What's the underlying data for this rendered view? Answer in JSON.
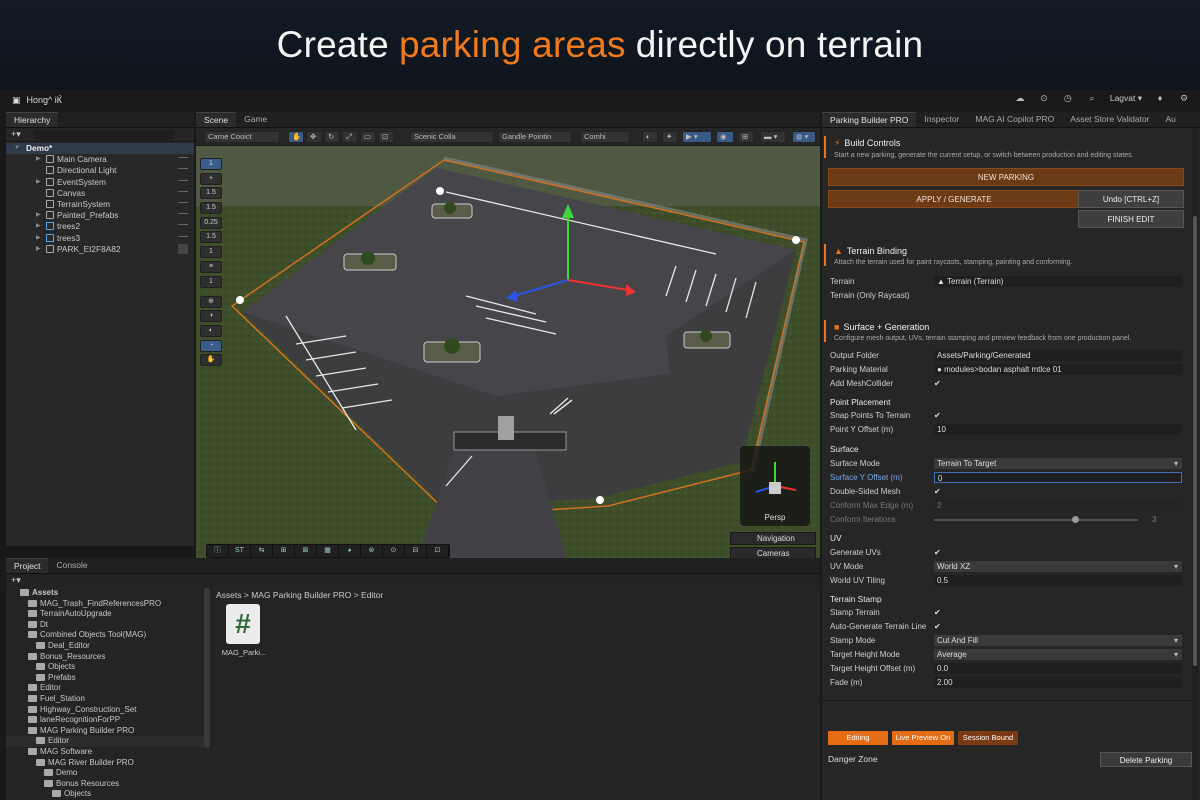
{
  "banner": {
    "prefix": "Create",
    "highlight": "parking areas",
    "suffix": "directly on terrain"
  },
  "topbar": {
    "title": "Hong^ iЌ",
    "account": "Lagvat ▾"
  },
  "hierarchy": {
    "tab": "Hierarchy",
    "scene": "Demo*",
    "items": [
      "Main Camera",
      "Directional Light",
      "EventSystem",
      "Canvas",
      "TerrainSystem",
      "Painted_Prefabs",
      "trees2",
      "trees3",
      "PARK_EI2F8A82"
    ]
  },
  "scene_view": {
    "tabs": [
      "Scene",
      "Game"
    ],
    "toolbar": {
      "camera": "Carne Cooict",
      "scene_coll": "Scenic Colla",
      "gizmos": "Gandle Pointin",
      "combi": "Comhi"
    },
    "vtools": [
      "1",
      "+",
      "1.5",
      "1.5",
      "0.25",
      "1.5",
      "1",
      "≡",
      "1",
      "⊕",
      "◑",
      "◐",
      "◔",
      "✋"
    ],
    "persp": "Persp",
    "navigation": "Navigation",
    "cameras": "Cameras",
    "bottom_tools": [
      "ⓘ",
      "ST",
      "⇆",
      "⊞",
      "⊠",
      "▦",
      "◕",
      "⊛",
      "⊙",
      "⊟",
      "⊡"
    ]
  },
  "project": {
    "tabs": [
      "Project",
      "Console"
    ],
    "tree": [
      "Assets",
      "MAG_Trash_FindReferencesPRO",
      "TerrainAutoUpgrade",
      "Dt",
      "Combined Objects Tool(MAG)",
      "Deal_Editor",
      "Bonus_Resources",
      "Objects",
      "Prefabs",
      "Editor",
      "Fuel_Station",
      "Highway_Construction_Set",
      "laneRecognitionForPP",
      "MAG Parking Builder PRO",
      "Editor",
      "MAG Software",
      "MAG River Builder PRO",
      "Demo",
      "Bonus Resources",
      "Objects"
    ],
    "breadcrumb": "Assets  >  MAG Parking Builder PRO  >  Editor",
    "file_name": "MAG_Parki...",
    "file_glyph": "#"
  },
  "inspector": {
    "tabs": [
      "Parking Builder PRO",
      "Inspector",
      "MAG AI Copilot PRO",
      "Asset Store Validator",
      "Au"
    ],
    "build": {
      "title": "Build Controls",
      "desc": "Start a new parking, generate the current setup, or switch between production and editing states.",
      "new_parking": "NEW PARKING",
      "apply": "APPLY / GENERATE",
      "undo": "Undo [CTRL+Z]",
      "finish": "FINISH EDIT"
    },
    "terrain": {
      "title": "Terrain Binding",
      "desc": "Attach the terrain used for paint raycasts, stamping, painting and conforming.",
      "label": "Terrain",
      "value": "Terrain (Terrain)",
      "raycast": "Terrain (Only Raycast)"
    },
    "surface": {
      "title": "Surface + Generation",
      "desc": "Configure mesh output, UVs, terrain stamping and preview feedback from one production panel.",
      "output_folder_label": "Output Folder",
      "output_folder": "Assets/Parking/Generated",
      "material_label": "Parking Material",
      "material": "modules>bodan asphalt mtlce 01",
      "collider_label": "Add MeshCollider",
      "point_placement": "Point Placement",
      "snap_label": "Snap Points To Terrain",
      "point_y_label": "Point Y Offset (m)",
      "point_y": "10",
      "surface_hdr": "Surface",
      "surface_mode_label": "Surface Mode",
      "surface_mode": "Terrain To Target",
      "surface_y_label": "Surface Y Offset (m)",
      "surface_y": "0",
      "double_label": "Double-Sided Mesh",
      "conform_edge_label": "Conform Max Edge (m)",
      "conform_edge": "2",
      "conform_iter_label": "Conform Iterations",
      "conform_iter": "3",
      "conform_iter_fraction": 0.7,
      "uv_hdr": "UV",
      "gen_uv_label": "Generate UVs",
      "uv_mode_label": "UV Mode",
      "uv_mode": "World XZ",
      "uv_tiling_label": "World UV Tiling",
      "uv_tiling": "0.5",
      "stamp_hdr": "Terrain Stamp",
      "stamp_label": "Stamp Terrain",
      "auto_label": "Auto-Generate Terrain Line",
      "stamp_mode_label": "Stamp Mode",
      "stamp_mode": "Cut And Fill",
      "height_mode_label": "Target Height Mode",
      "height_mode": "Average",
      "height_off_label": "Target Height Offset (m)",
      "height_off": "0.0",
      "fade_label": "Fade (m)",
      "fade": "2.00"
    },
    "status": {
      "editing": "Editing",
      "live": "Live Preview On",
      "session": "Session Bound"
    },
    "danger": {
      "label": "Danger Zone",
      "button": "Delete Parking"
    }
  },
  "colors": {
    "accent": "#f07a1c",
    "editor_bg": "#191919"
  }
}
